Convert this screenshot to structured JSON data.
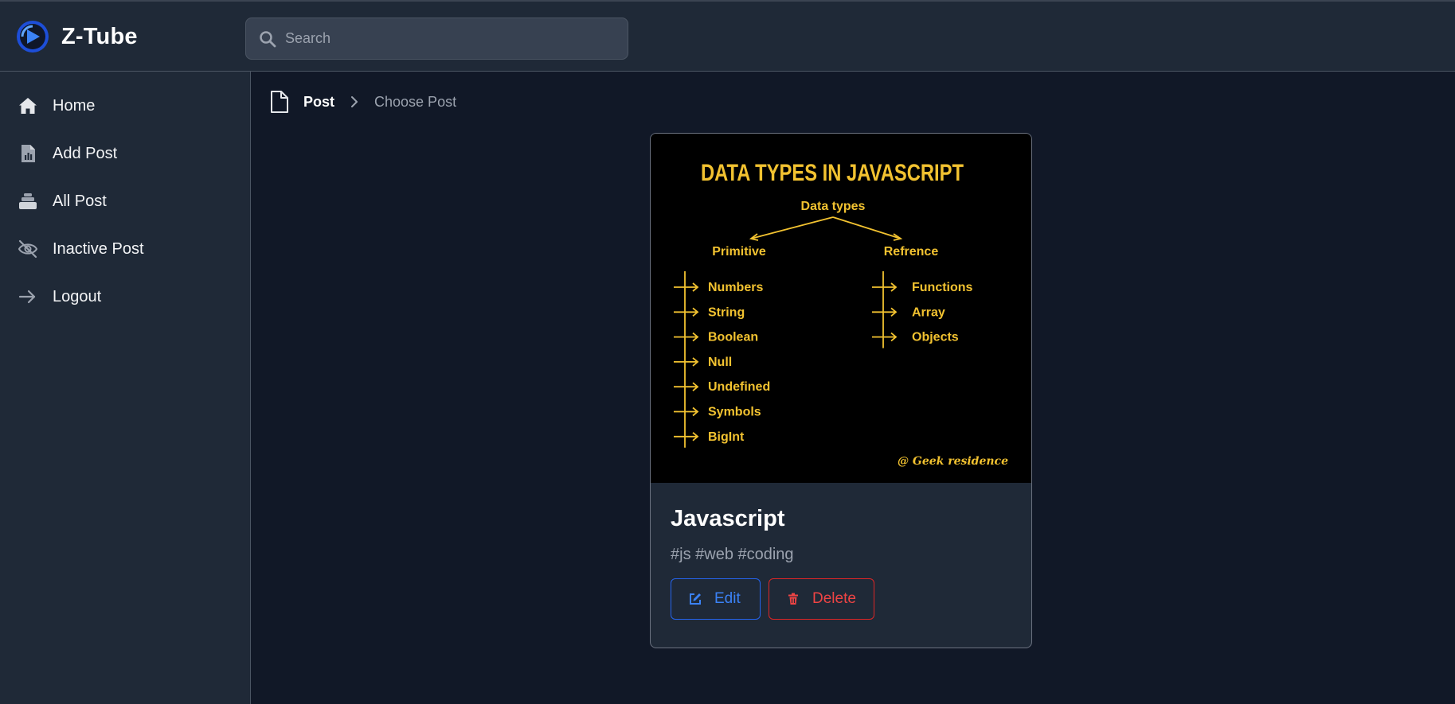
{
  "app": {
    "name": "Z-Tube"
  },
  "search": {
    "placeholder": "Search",
    "value": ""
  },
  "sidebar": {
    "items": [
      {
        "label": "Home",
        "icon": "home-icon"
      },
      {
        "label": "Add Post",
        "icon": "document-chart-icon"
      },
      {
        "label": "All Post",
        "icon": "stack-icon"
      },
      {
        "label": "Inactive Post",
        "icon": "eye-slash-icon"
      },
      {
        "label": "Logout",
        "icon": "arrow-right-icon"
      }
    ]
  },
  "breadcrumb": {
    "root": "Post",
    "current": "Choose Post"
  },
  "post": {
    "title": "Javascript",
    "tags": "#js #web #coding",
    "edit_label": "Edit",
    "delete_label": "Delete",
    "image": {
      "heading": "DATA TYPES IN JAVASCRIPT",
      "root": "Data types",
      "left_branch": "Primitive",
      "right_branch": "Refrence",
      "primitive": [
        "Numbers",
        "String",
        "Boolean",
        "Null",
        "Undefined",
        "Symbols",
        "BigInt"
      ],
      "reference": [
        "Functions",
        "Array",
        "Objects"
      ],
      "credit": "@ Geek residence"
    }
  },
  "colors": {
    "background": "#111827",
    "panel": "#1f2937",
    "accent_blue": "#3b82f6",
    "danger_red": "#ef4444",
    "image_yellow": "#f2c230"
  }
}
